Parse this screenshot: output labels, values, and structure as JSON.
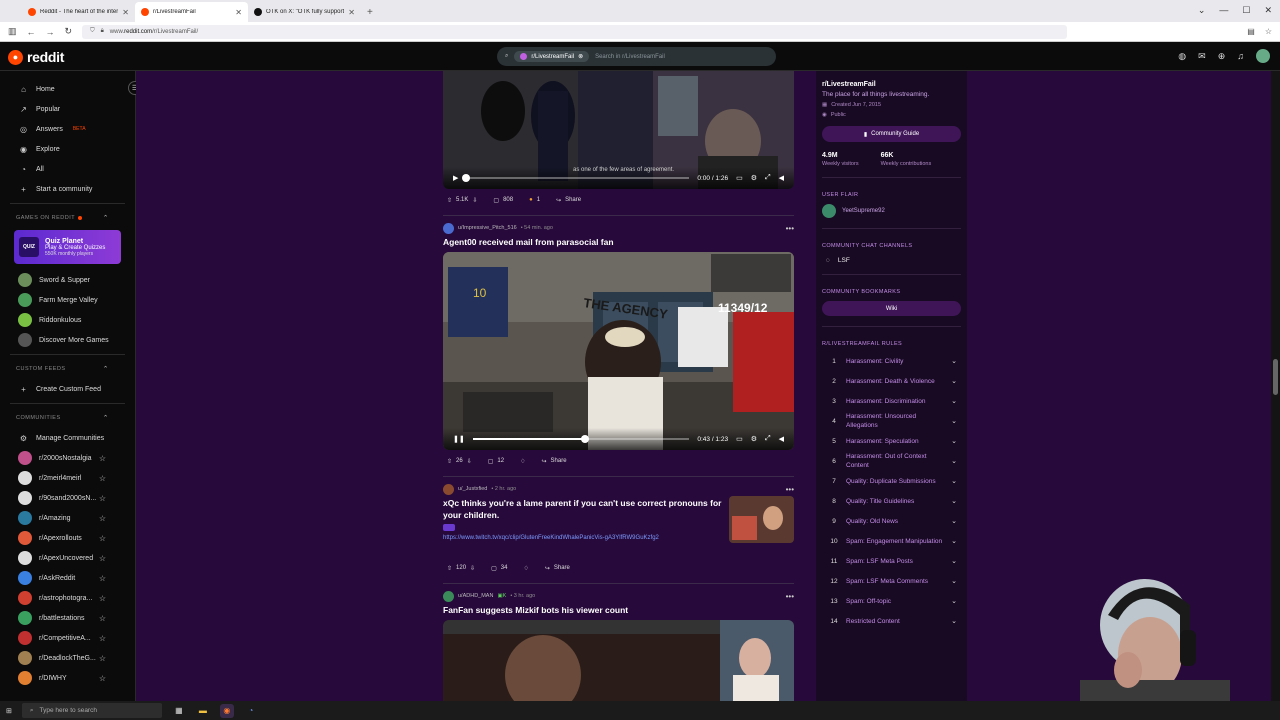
{
  "browser": {
    "tabs": [
      {
        "title": "Reddit - The heart of the intern",
        "active": false,
        "color": "#ff4500"
      },
      {
        "title": "r/LivestreamFail",
        "active": true,
        "color": "#ff4500"
      },
      {
        "title": "OTK on X: \"OTK fully supports a",
        "active": false,
        "color": "#111111"
      }
    ],
    "url_prefix": "www.",
    "url_domain": "reddit.com",
    "url_path": "/r/LivestreamFail/"
  },
  "header": {
    "logo_text": "reddit",
    "search_chip": "r/LivestreamFail",
    "search_placeholder": "Search in r/LivestreamFail"
  },
  "sidebar": {
    "nav": [
      {
        "label": "Home",
        "icon": "home-icon",
        "glyph": "⌂"
      },
      {
        "label": "Popular",
        "icon": "popular-icon",
        "glyph": "↗"
      },
      {
        "label": "Answers",
        "icon": "answers-icon",
        "glyph": "◎",
        "badge": "BETA"
      },
      {
        "label": "Explore",
        "icon": "explore-icon",
        "glyph": "◉"
      },
      {
        "label": "All",
        "icon": "all-icon",
        "glyph": "◔"
      },
      {
        "label": "Start a community",
        "icon": "plus-icon",
        "glyph": "+"
      }
    ],
    "games_header": "GAMES ON REDDIT",
    "quiz": {
      "title": "Quiz Planet",
      "subtitle": "Play & Create Quizzes",
      "players": "550K monthly players",
      "icon_text": "QUIZ"
    },
    "games": [
      {
        "label": "Sword & Supper",
        "color": "#6b8e5a"
      },
      {
        "label": "Farm Merge Valley",
        "color": "#4a9a5a"
      },
      {
        "label": "Riddonkulous",
        "color": "#7ac043"
      },
      {
        "label": "Discover More Games",
        "color": "#555555"
      }
    ],
    "custom_header": "CUSTOM FEEDS",
    "create_feed": "Create Custom Feed",
    "communities_header": "COMMUNITIES",
    "manage": "Manage Communities",
    "communities": [
      {
        "label": "r/2000sNostalgia",
        "color": "#c0508a"
      },
      {
        "label": "r/2meirl4meirl",
        "color": "#dddddd"
      },
      {
        "label": "r/90sand2000sN...",
        "color": "#dddddd"
      },
      {
        "label": "r/Amazing",
        "color": "#2a7aa0"
      },
      {
        "label": "r/Apexrollouts",
        "color": "#e05a3a"
      },
      {
        "label": "r/ApexUncovered",
        "color": "#dddddd"
      },
      {
        "label": "r/AskReddit",
        "color": "#3a80e0"
      },
      {
        "label": "r/astrophotogra...",
        "color": "#d04030"
      },
      {
        "label": "r/battlestations",
        "color": "#3aa060"
      },
      {
        "label": "r/CompetitiveA...",
        "color": "#c03030"
      },
      {
        "label": "r/DeadlockTheG...",
        "color": "#a08050"
      },
      {
        "label": "r/DIWHY",
        "color": "#e08030"
      }
    ]
  },
  "feed": {
    "post0": {
      "votes": "5.1K",
      "comments": "808",
      "awards": "1",
      "share": "Share",
      "time": "0:00 / 1:26",
      "progress": 0.0
    },
    "post1": {
      "author": "u/Impressive_Pitch_516",
      "time_ago": "54 min. ago",
      "title": "Agent00 received mail from parasocial fan",
      "votes": "26",
      "comments": "12",
      "share": "Share",
      "video_time": "0:43 / 1:23",
      "progress": 0.52,
      "overlay_text": "11349/12",
      "sign_text": "THE AGENCY"
    },
    "post2": {
      "author": "u/_Justxfied",
      "time_ago": "2 hr. ago",
      "title": "xQc thinks you're a lame parent if you can't use correct pronouns for your children.",
      "link": "https://www.twitch.tv/xqc/clip/GlutenFreeKindWhalePanicVis-gA3YlfRW9GuKzfg2",
      "votes": "120",
      "comments": "34",
      "share": "Share"
    },
    "post3": {
      "author": "u/ADHD_MAN",
      "time_ago": "3 hr. ago",
      "title": "FanFan suggests Mizkif bots his viewer count"
    }
  },
  "community": {
    "name": "r/LivestreamFail",
    "description": "The place for all things livestreaming.",
    "created": "Created Jun 7, 2015",
    "visibility": "Public",
    "guide_label": "Community Guide",
    "visitors": "4.9M",
    "visitors_label": "Weekly visitors",
    "contributions": "66K",
    "contributions_label": "Weekly contributions",
    "flair_header": "USER FLAIR",
    "flair_user": "YeetSupreme92",
    "chat_header": "COMMUNITY CHAT CHANNELS",
    "chat_channel": "LSF",
    "bookmarks_header": "COMMUNITY BOOKMARKS",
    "wiki_label": "Wiki",
    "rules_header": "R/LIVESTREAMFAIL RULES",
    "rules": [
      {
        "n": "1",
        "label": "Harassment: Civility"
      },
      {
        "n": "2",
        "label": "Harassment: Death & Violence"
      },
      {
        "n": "3",
        "label": "Harassment: Discrimination"
      },
      {
        "n": "4",
        "label": "Harassment: Unsourced Allegations"
      },
      {
        "n": "5",
        "label": "Harassment: Speculation"
      },
      {
        "n": "6",
        "label": "Harassment: Out of Context Content"
      },
      {
        "n": "7",
        "label": "Quality: Duplicate Submissions"
      },
      {
        "n": "8",
        "label": "Quality: Title Guidelines"
      },
      {
        "n": "9",
        "label": "Quality: Old News"
      },
      {
        "n": "10",
        "label": "Spam: Engagement Manipulation"
      },
      {
        "n": "11",
        "label": "Spam: LSF Meta Posts"
      },
      {
        "n": "12",
        "label": "Spam: LSF Meta Comments"
      },
      {
        "n": "13",
        "label": "Spam: Off-topic"
      },
      {
        "n": "14",
        "label": "Restricted Content"
      }
    ]
  },
  "taskbar": {
    "search_placeholder": "Type here to search"
  },
  "colors": {
    "brand": "#ff4500",
    "community_bg": "#27093b",
    "accent": "#c38ce8"
  }
}
